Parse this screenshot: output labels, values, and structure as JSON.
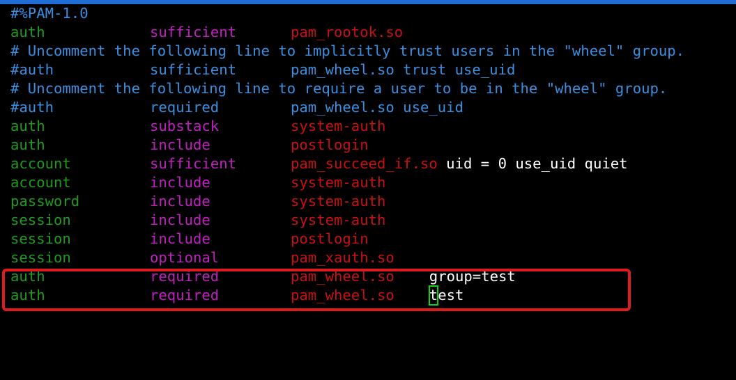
{
  "header_line": "#%PAM-1.0",
  "lines": [
    {
      "kind": "entry",
      "type": "auth",
      "control": "sufficient",
      "module": "pam_rootok.so",
      "args": ""
    },
    {
      "kind": "comment",
      "text": "# Uncomment the following line to implicitly trust users in the \"wheel\" group."
    },
    {
      "kind": "commented",
      "type": "#auth",
      "control": "sufficient",
      "module": "pam_wheel.so trust use_uid"
    },
    {
      "kind": "comment",
      "text": "# Uncomment the following line to require a user to be in the \"wheel\" group."
    },
    {
      "kind": "commented",
      "type": "#auth",
      "control": "required",
      "module": "pam_wheel.so use_uid"
    },
    {
      "kind": "entry",
      "type": "auth",
      "control": "substack",
      "module": "system-auth",
      "args": ""
    },
    {
      "kind": "entry",
      "type": "auth",
      "control": "include",
      "module": "postlogin",
      "args": ""
    },
    {
      "kind": "entry",
      "type": "account",
      "control": "sufficient",
      "module": "pam_succeed_if.so",
      "args": " uid = 0 use_uid quiet"
    },
    {
      "kind": "entry",
      "type": "account",
      "control": "include",
      "module": "system-auth",
      "args": ""
    },
    {
      "kind": "entry",
      "type": "password",
      "control": "include",
      "module": "system-auth",
      "args": ""
    },
    {
      "kind": "entry",
      "type": "session",
      "control": "include",
      "module": "system-auth",
      "args": ""
    },
    {
      "kind": "entry",
      "type": "session",
      "control": "include",
      "module": "postlogin",
      "args": ""
    },
    {
      "kind": "entry",
      "type": "session",
      "control": "optional",
      "module": "pam_xauth.so",
      "args": ""
    },
    {
      "kind": "entry",
      "type": "auth",
      "control": "required",
      "module": "pam_wheel.so",
      "args": "group=test"
    },
    {
      "kind": "entry",
      "type": "auth",
      "control": "required",
      "module": "pam_wheel.so",
      "args": "test",
      "cursor_char": "t",
      "rest": "est"
    }
  ],
  "colors": {
    "background": "#000000",
    "comment": "#3b8fe0",
    "pam_type": "#1e9a1e",
    "pam_control": "#c020c0",
    "pam_module": "#c81010",
    "plain_text": "#ffffff",
    "highlight_box": "#e01b1b",
    "cursor": "#12d012"
  }
}
